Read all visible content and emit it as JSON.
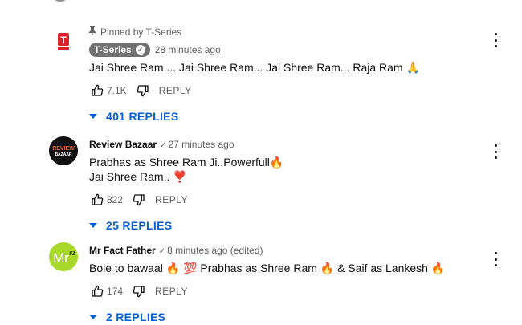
{
  "comments": [
    {
      "pinned_label": "Pinned by T-Series",
      "author": "T-Series",
      "time": "28 minutes ago",
      "text_lines": [
        "Jai Shree Ram.... Jai Shree Ram... Jai Shree Ram... Raja Ram 🙏"
      ],
      "likes": "7.1K",
      "reply_label": "REPLY",
      "replies_label": "401 REPLIES",
      "avatar_text": "T",
      "avatar_color": "#d8232a"
    },
    {
      "author": "Review Bazaar",
      "time": "27 minutes ago",
      "text_lines": [
        "Prabhas as Shree Ram Ji..Powerfull🔥",
        "Jai Shree Ram.. ❣️"
      ],
      "likes": "822",
      "reply_label": "REPLY",
      "replies_label": "25 REPLIES",
      "avatar_text_1": "REVIEW",
      "avatar_text_2": "BAZAAR",
      "avatar_color": "#111111"
    },
    {
      "author": "Mr Fact Father",
      "time": "8 minutes ago (edited)",
      "text_lines": [
        "Bole to bawaal 🔥 💯  Prabhas as Shree Ram  🔥  & Saif as Lankesh  🔥"
      ],
      "likes": "174",
      "reply_label": "REPLY",
      "replies_label": "2 REPLIES",
      "avatar_text": "Mr",
      "avatar_badge": "FZ",
      "avatar_color": "#a7d82a"
    }
  ],
  "icons": {
    "like": "thumbs-up-icon",
    "dislike": "thumbs-down-icon",
    "more": "more-vert-icon",
    "pin": "pin-icon",
    "expand": "caret-down-icon"
  },
  "colors": {
    "link_blue": "#065fd4",
    "meta_grey": "#606060",
    "pill_grey": "#717171"
  }
}
